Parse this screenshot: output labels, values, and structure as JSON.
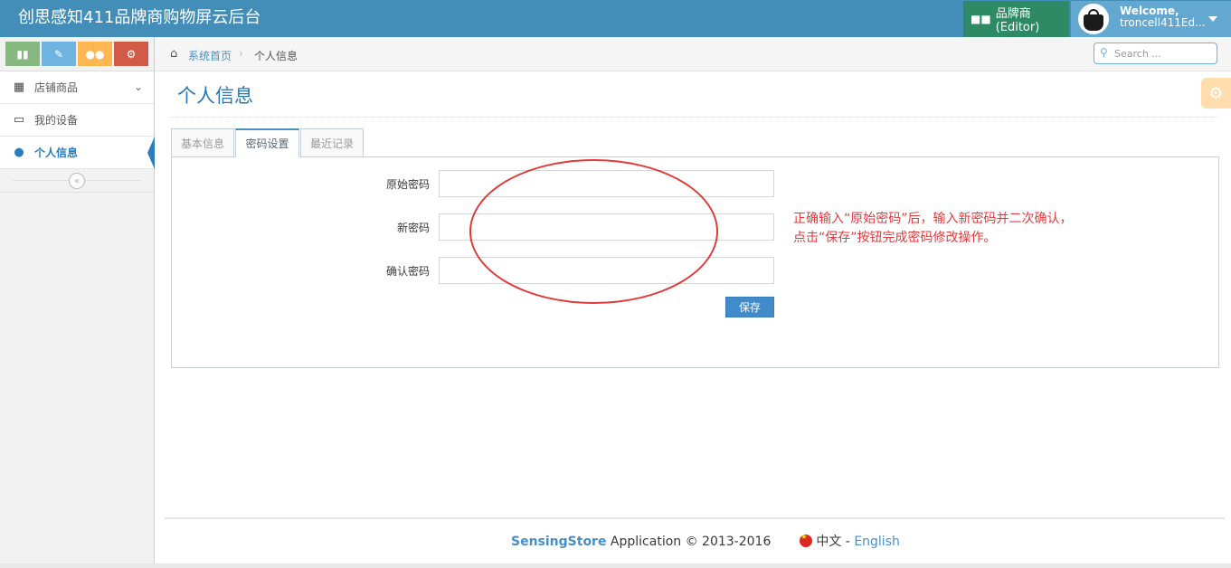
{
  "app": {
    "title": "创思感知411品牌商购物屏云后台",
    "role_label": "品牌商(Editor)",
    "welcome": "Welcome,",
    "username": "troncell411Ed..."
  },
  "sidebar": {
    "shortcuts": [
      "signal-icon",
      "pencil-icon",
      "group-icon",
      "cogs-icon"
    ],
    "items": [
      {
        "label": "店铺商品",
        "icon": "cubes-icon",
        "has_submenu": true
      },
      {
        "label": "我的设备",
        "icon": "laptop-icon",
        "has_submenu": false
      },
      {
        "label": "个人信息",
        "icon": "user-icon",
        "active": true
      }
    ]
  },
  "breadcrumb": {
    "home": "系统首页",
    "current": "个人信息"
  },
  "search": {
    "placeholder": "Search ..."
  },
  "page": {
    "title": "个人信息"
  },
  "tabs": [
    {
      "label": "基本信息",
      "active": false
    },
    {
      "label": "密码设置",
      "active": true
    },
    {
      "label": "最近记录",
      "active": false
    }
  ],
  "form": {
    "old_password_label": "原始密码",
    "new_password_label": "新密码",
    "confirm_password_label": "确认密码",
    "old_password_value": "",
    "new_password_value": "",
    "confirm_password_value": "",
    "save_label": "保存"
  },
  "annotation": {
    "line1": "正确输入“原始密码”后，输入新密码并二次确认，",
    "line2": "点击“保存”按钮完成密码修改操作。",
    "color": "#e23a3a"
  },
  "footer": {
    "app_name": "SensingStore",
    "app_text": " Application © 2013-2016",
    "lang_cn": "中文",
    "lang_sep": " - ",
    "lang_en": "English"
  },
  "colors": {
    "navbar": "#438eb9",
    "role": "#2e8965",
    "user": "#62a8d1",
    "accent": "#2679b5"
  }
}
